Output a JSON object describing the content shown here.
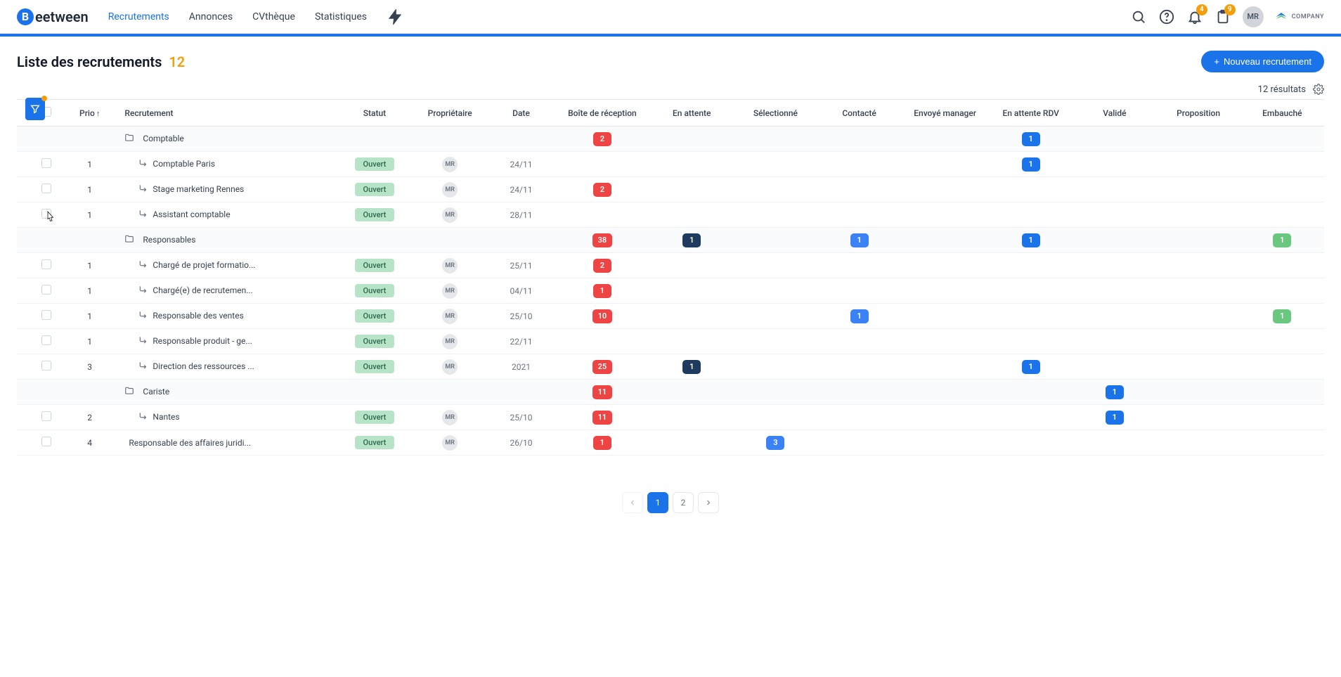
{
  "logo": {
    "letter": "B",
    "rest": "eetween"
  },
  "nav": {
    "links": [
      "Recrutements",
      "Annonces",
      "CVthèque",
      "Statistiques"
    ],
    "activeIndex": 0,
    "bellBadge": "4",
    "clipboardBadge": "9",
    "avatar": "MR",
    "company": "COMPANY"
  },
  "page": {
    "title": "Liste des recrutements",
    "count": "12",
    "newBtn": "Nouveau recrutement",
    "resultsText": "12 résultats"
  },
  "columns": {
    "prio": "Prio",
    "recrutement": "Recrutement",
    "statut": "Statut",
    "proprietaire": "Propriétaire",
    "date": "Date",
    "boite": "Boîte de réception",
    "attente": "En attente",
    "selectionne": "Sélectionné",
    "contacte": "Contacté",
    "envoye": "Envoyé manager",
    "attenteRdv": "En attente RDV",
    "valide": "Validé",
    "proposition": "Proposition",
    "embauche": "Embauché"
  },
  "rows": [
    {
      "type": "folder",
      "name": "Comptable",
      "stages": {
        "boite": {
          "v": "2",
          "c": "red"
        },
        "attenteRdv": {
          "v": "1",
          "c": "blue"
        }
      }
    },
    {
      "type": "item",
      "prio": "1",
      "name": "Comptable Paris",
      "statut": "Ouvert",
      "owner": "MR",
      "date": "24/11",
      "stages": {
        "attenteRdv": {
          "v": "1",
          "c": "blue"
        }
      }
    },
    {
      "type": "item",
      "prio": "1",
      "name": "Stage marketing Rennes",
      "statut": "Ouvert",
      "owner": "MR",
      "date": "24/11",
      "stages": {
        "boite": {
          "v": "2",
          "c": "red"
        }
      }
    },
    {
      "type": "item",
      "prio": "1",
      "name": "Assistant comptable",
      "statut": "Ouvert",
      "owner": "MR",
      "date": "28/11",
      "stages": {}
    },
    {
      "type": "folder",
      "name": "Responsables",
      "stages": {
        "boite": {
          "v": "38",
          "c": "red"
        },
        "attente": {
          "v": "1",
          "c": "navy"
        },
        "contacte": {
          "v": "1",
          "c": "lightblue"
        },
        "attenteRdv": {
          "v": "1",
          "c": "blue"
        },
        "embauche": {
          "v": "1",
          "c": "green"
        }
      }
    },
    {
      "type": "item",
      "prio": "1",
      "name": "Chargé de projet formatio...",
      "statut": "Ouvert",
      "owner": "MR",
      "date": "25/11",
      "stages": {
        "boite": {
          "v": "2",
          "c": "red"
        }
      }
    },
    {
      "type": "item",
      "prio": "1",
      "name": "Chargé(e) de recrutemen...",
      "statut": "Ouvert",
      "owner": "MR",
      "date": "04/11",
      "stages": {
        "boite": {
          "v": "1",
          "c": "red"
        }
      }
    },
    {
      "type": "item",
      "prio": "1",
      "name": "Responsable des ventes",
      "statut": "Ouvert",
      "owner": "MR",
      "date": "25/10",
      "stages": {
        "boite": {
          "v": "10",
          "c": "red"
        },
        "contacte": {
          "v": "1",
          "c": "lightblue"
        },
        "embauche": {
          "v": "1",
          "c": "green"
        }
      }
    },
    {
      "type": "item",
      "prio": "1",
      "name": "Responsable produit - ge...",
      "statut": "Ouvert",
      "owner": "MR",
      "date": "22/11",
      "stages": {}
    },
    {
      "type": "item",
      "prio": "3",
      "name": "Direction des ressources ...",
      "statut": "Ouvert",
      "owner": "MR",
      "date": "2021",
      "stages": {
        "boite": {
          "v": "25",
          "c": "red"
        },
        "attente": {
          "v": "1",
          "c": "navy"
        },
        "attenteRdv": {
          "v": "1",
          "c": "blue"
        }
      }
    },
    {
      "type": "folder",
      "name": "Cariste",
      "stages": {
        "boite": {
          "v": "11",
          "c": "red"
        },
        "valide": {
          "v": "1",
          "c": "blue"
        }
      }
    },
    {
      "type": "item",
      "prio": "2",
      "name": "Nantes",
      "statut": "Ouvert",
      "owner": "MR",
      "date": "25/10",
      "stages": {
        "boite": {
          "v": "11",
          "c": "red"
        },
        "valide": {
          "v": "1",
          "c": "blue"
        }
      }
    },
    {
      "type": "top",
      "prio": "4",
      "name": "Responsable des affaires juridi...",
      "statut": "Ouvert",
      "owner": "MR",
      "date": "26/10",
      "stages": {
        "boite": {
          "v": "1",
          "c": "red"
        },
        "selectionne": {
          "v": "3",
          "c": "lightblue"
        }
      }
    }
  ],
  "pagination": {
    "pages": [
      "1",
      "2"
    ],
    "active": 0
  }
}
